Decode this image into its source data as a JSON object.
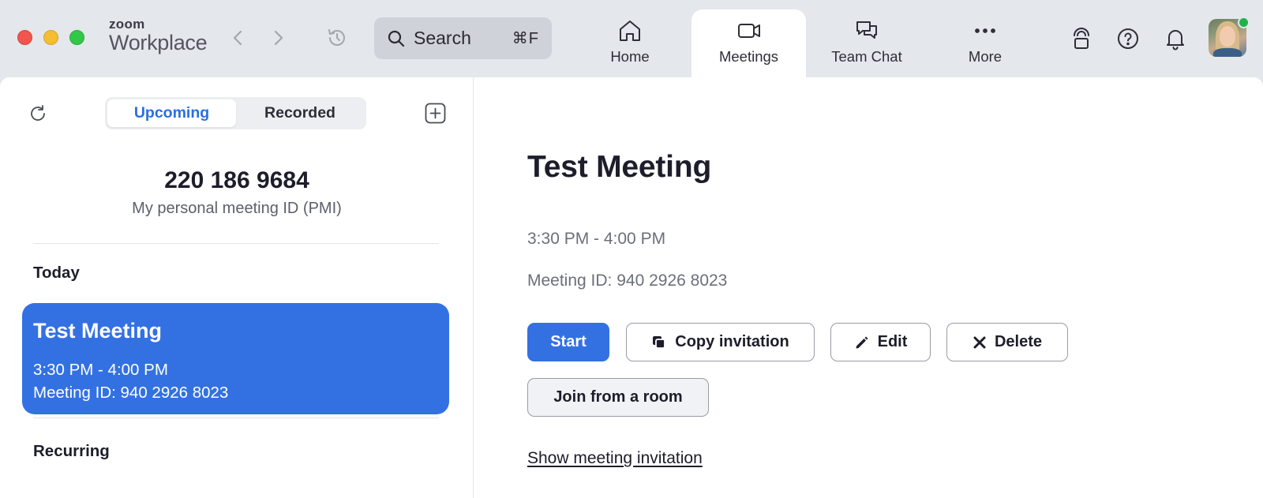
{
  "app": {
    "brand_small": "zoom",
    "brand_large": "Workplace"
  },
  "search": {
    "label": "Search",
    "shortcut": "⌘F"
  },
  "nav_tabs": [
    {
      "label": "Home",
      "icon": "home-icon"
    },
    {
      "label": "Meetings",
      "icon": "video-camera-icon",
      "active": true
    },
    {
      "label": "Team Chat",
      "icon": "chat-bubbles-icon"
    },
    {
      "label": "More",
      "icon": "more-dots-icon"
    }
  ],
  "left_panel": {
    "tabs": {
      "upcoming": "Upcoming",
      "recorded": "Recorded"
    },
    "pmi": {
      "number": "220 186 9684",
      "label": "My personal meeting ID (PMI)"
    },
    "sections": {
      "today": "Today",
      "recurring": "Recurring"
    },
    "meeting_card": {
      "title": "Test Meeting",
      "time": "3:30 PM - 4:00 PM",
      "meeting_id": "Meeting ID: 940 2926 8023"
    }
  },
  "detail": {
    "title": "Test Meeting",
    "time": "3:30 PM - 4:00 PM",
    "meeting_id": "Meeting ID: 940 2926 8023",
    "buttons": {
      "start": "Start",
      "copy": "Copy invitation",
      "edit": "Edit",
      "delete": "Delete",
      "join_room": "Join from a room"
    },
    "show_invitation": "Show meeting invitation"
  },
  "colors": {
    "accent": "#3371e3",
    "titlebar_bg": "#e4e7ec",
    "status_online": "#22b14c"
  }
}
